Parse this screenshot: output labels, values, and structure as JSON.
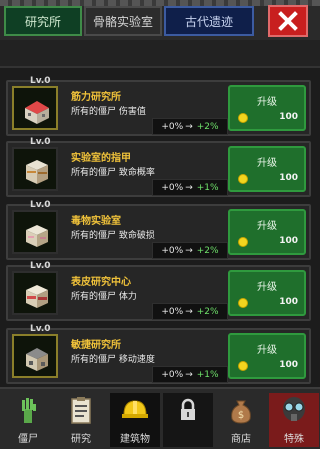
{
  "tabs": [
    {
      "label": "研究所"
    },
    {
      "label": "骨骼实验室"
    },
    {
      "label": "古代遗迹"
    }
  ],
  "close_icon": "close-icon",
  "research_items": [
    {
      "level": "Lv.0",
      "name": "筋力研究所",
      "desc": "所有的僵尸 伤害值",
      "from": "+0%",
      "to": "+2%",
      "button": "升级",
      "cost": "100"
    },
    {
      "level": "Lv.0",
      "name": "实验室的指甲",
      "desc": "所有的僵尸 致命概率",
      "from": "+0%",
      "to": "+1%",
      "button": "升级",
      "cost": "100"
    },
    {
      "level": "Lv.0",
      "name": "毒物实验室",
      "desc": "所有的僵尸 致命破损",
      "from": "+0%",
      "to": "+2%",
      "button": "升级",
      "cost": "100"
    },
    {
      "level": "Lv.0",
      "name": "表皮研究中心",
      "desc": "所有的僵尸 体力",
      "from": "+0%",
      "to": "+2%",
      "button": "升级",
      "cost": "100"
    },
    {
      "level": "Lv.0",
      "name": "敏捷研究所",
      "desc": "所有的僵尸 移动速度",
      "from": "+0%",
      "to": "+1%",
      "button": "升级",
      "cost": "100"
    }
  ],
  "arrow": "→",
  "bottom_nav": [
    {
      "label": "僵尸",
      "icon": "zombie-hand-icon"
    },
    {
      "label": "研究",
      "icon": "clipboard-icon"
    },
    {
      "label": "建筑物",
      "icon": "hardhat-icon"
    },
    {
      "label": "",
      "icon": "lock-icon"
    },
    {
      "label": "商店",
      "icon": "money-bag-icon"
    },
    {
      "label": "特殊",
      "icon": "gas-mask-icon"
    }
  ],
  "colors": {
    "accent_green": "#1f6f2c",
    "name_gold": "#f0c23a",
    "bonus_green": "#6ee06a",
    "close_red": "#c81f1f"
  }
}
